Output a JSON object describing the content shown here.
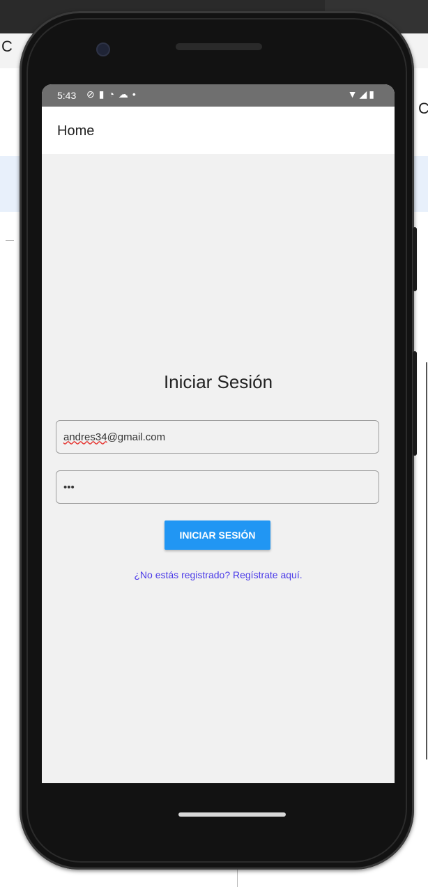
{
  "desktop": {
    "left_letter": "C",
    "right_letter": "C"
  },
  "status_bar": {
    "time": "5:43",
    "left_icons": [
      "shield-icon",
      "sd-card-icon",
      "sync-icon",
      "cloud-icon",
      "dot-icon"
    ],
    "right_icons": [
      "wifi-icon",
      "signal-icon",
      "battery-icon"
    ]
  },
  "app_bar": {
    "title": "Home"
  },
  "login": {
    "title": "Iniciar Sesión",
    "email_user": "andres34",
    "email_domain": "@gmail.com",
    "password_masked": "•••",
    "button_label": "INICIAR SESIÓN",
    "register_link": "¿No estás registrado? Regístrate aquí."
  },
  "colors": {
    "accent": "#2196f3",
    "link": "#4a3ae8",
    "status_bar": "#6f6f6f"
  }
}
